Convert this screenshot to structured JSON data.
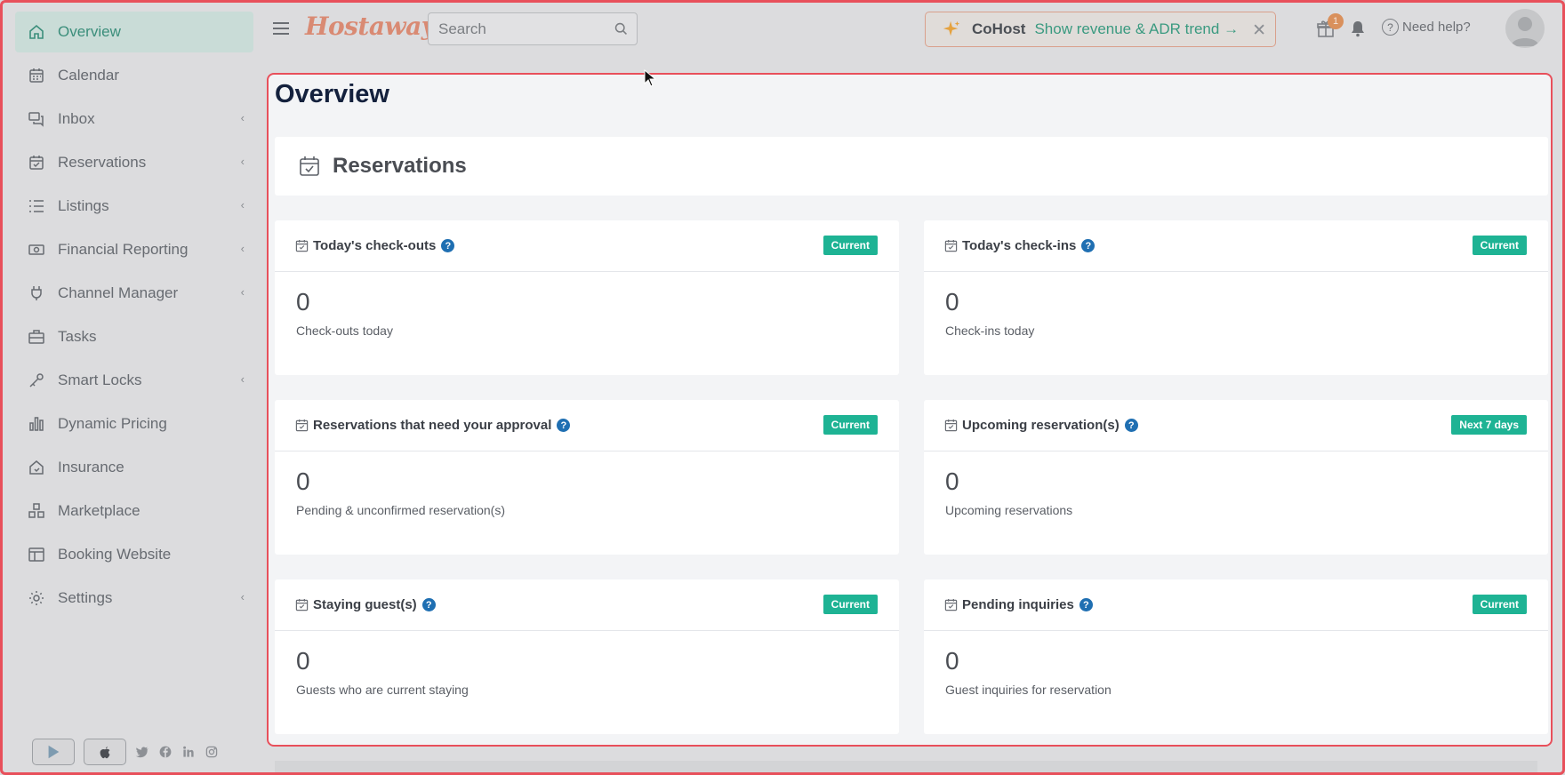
{
  "sidebar": {
    "items": [
      {
        "label": "Overview",
        "icon": "home-icon",
        "active": true,
        "chevron": false
      },
      {
        "label": "Calendar",
        "icon": "calendar-icon",
        "active": false,
        "chevron": false
      },
      {
        "label": "Inbox",
        "icon": "chat-icon",
        "active": false,
        "chevron": true
      },
      {
        "label": "Reservations",
        "icon": "calendar-check-icon",
        "active": false,
        "chevron": true
      },
      {
        "label": "Listings",
        "icon": "list-icon",
        "active": false,
        "chevron": true
      },
      {
        "label": "Financial Reporting",
        "icon": "money-icon",
        "active": false,
        "chevron": true
      },
      {
        "label": "Channel Manager",
        "icon": "plug-icon",
        "active": false,
        "chevron": true
      },
      {
        "label": "Tasks",
        "icon": "briefcase-icon",
        "active": false,
        "chevron": false
      },
      {
        "label": "Smart Locks",
        "icon": "key-icon",
        "active": false,
        "chevron": true
      },
      {
        "label": "Dynamic Pricing",
        "icon": "bar-chart-icon",
        "active": false,
        "chevron": false
      },
      {
        "label": "Insurance",
        "icon": "house-shield-icon",
        "active": false,
        "chevron": false
      },
      {
        "label": "Marketplace",
        "icon": "boxes-icon",
        "active": false,
        "chevron": false
      },
      {
        "label": "Booking Website",
        "icon": "layout-icon",
        "active": false,
        "chevron": false
      },
      {
        "label": "Settings",
        "icon": "gear-icon",
        "active": false,
        "chevron": true
      }
    ],
    "chevron_glyph": "‹"
  },
  "header": {
    "logo": "Hostaway",
    "search_placeholder": "Search",
    "cohost": {
      "name": "CoHost",
      "link": "Show revenue & ADR trend →",
      "close": "✕"
    },
    "gift_badge": "1",
    "help": "Need help?"
  },
  "page": {
    "title": "Overview",
    "section_title": "Reservations"
  },
  "cards": [
    {
      "title": "Today's check-outs",
      "badge": "Current",
      "value": "0",
      "label": "Check-outs today"
    },
    {
      "title": "Today's check-ins",
      "badge": "Current",
      "value": "0",
      "label": "Check-ins today"
    },
    {
      "title": "Reservations that need your approval",
      "badge": "Current",
      "value": "0",
      "label": "Pending & unconfirmed reservation(s)"
    },
    {
      "title": "Upcoming reservation(s)",
      "badge": "Next 7 days",
      "value": "0",
      "label": "Upcoming reservations"
    },
    {
      "title": "Staying guest(s)",
      "badge": "Current",
      "value": "0",
      "label": "Guests who are current staying"
    },
    {
      "title": "Pending inquiries",
      "badge": "Current",
      "value": "0",
      "label": "Guest inquiries for reservation"
    }
  ],
  "colors": {
    "accent_green": "#1eb394",
    "highlight_red": "#e8505b",
    "brand_orange": "#d98a73",
    "help_blue": "#1f6fb2"
  }
}
